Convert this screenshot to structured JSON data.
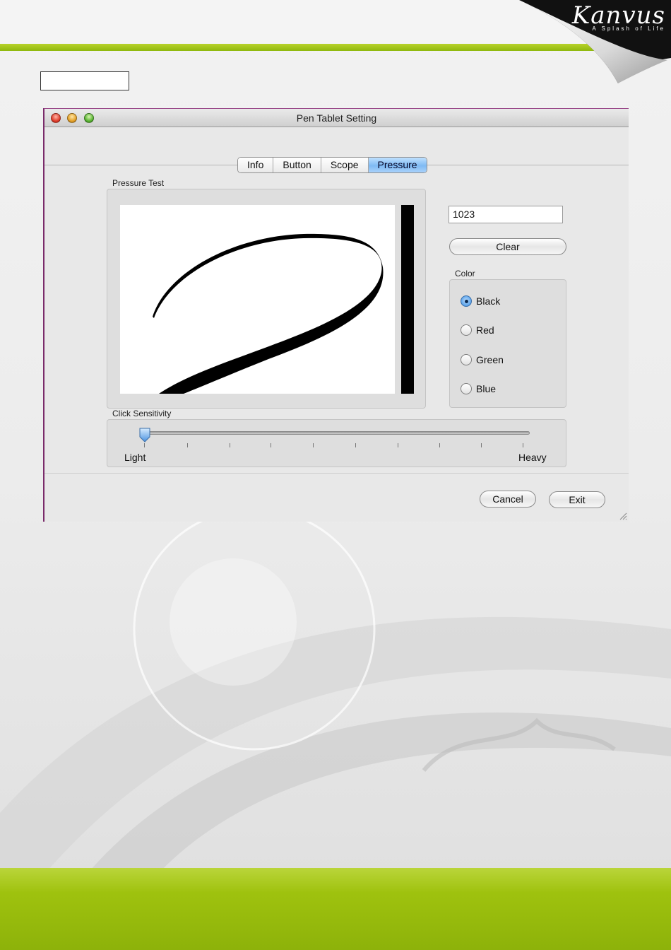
{
  "brand": {
    "logo": "Kanvus",
    "tagline": "A Splash of Life"
  },
  "window": {
    "title": "Pen Tablet Setting"
  },
  "tabs": [
    {
      "label": "Info",
      "active": false
    },
    {
      "label": "Button",
      "active": false
    },
    {
      "label": "Scope",
      "active": false
    },
    {
      "label": "Pressure",
      "active": true
    }
  ],
  "pressure_test": {
    "label": "Pressure Test",
    "value": "1023",
    "clear_label": "Clear"
  },
  "color": {
    "label": "Color",
    "options": [
      "Black",
      "Red",
      "Green",
      "Blue"
    ],
    "selected": "Black"
  },
  "sensitivity": {
    "label": "Click Sensitivity",
    "min_label": "Light",
    "max_label": "Heavy",
    "level": 0,
    "ticks": 10
  },
  "buttons": {
    "cancel": "Cancel",
    "exit": "Exit"
  },
  "colors": {
    "accent": "#7fbaf3",
    "green": "#9fc20e"
  }
}
